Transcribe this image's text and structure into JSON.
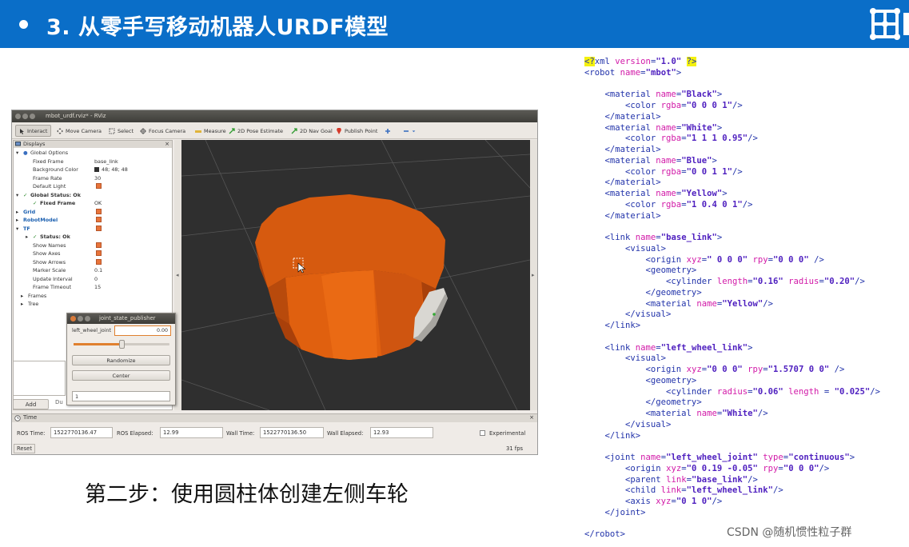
{
  "header": {
    "title": "3. 从零手写移动机器人URDF模型",
    "accent_color": "#0a6ec8"
  },
  "rviz": {
    "window_title": "mbot_urdf.rviz* - RViz",
    "toolbar": [
      {
        "label": "Interact",
        "icon": "interact-icon"
      },
      {
        "label": "Move Camera",
        "icon": "move-camera-icon"
      },
      {
        "label": "Select",
        "icon": "select-icon"
      },
      {
        "label": "Focus Camera",
        "icon": "focus-camera-icon"
      },
      {
        "label": "Measure",
        "icon": "measure-icon"
      },
      {
        "label": "2D Pose Estimate",
        "icon": "pose-estimate-icon"
      },
      {
        "label": "2D Nav Goal",
        "icon": "nav-goal-icon"
      },
      {
        "label": "Publish Point",
        "icon": "publish-point-icon"
      }
    ],
    "displays": {
      "title": "Displays",
      "rows": [
        {
          "label": "Global Options",
          "value": ""
        },
        {
          "label": "Fixed Frame",
          "value": "base_link"
        },
        {
          "label": "Background Color",
          "value": "48; 48; 48"
        },
        {
          "label": "Frame Rate",
          "value": "30"
        },
        {
          "label": "Default Light",
          "value": ""
        },
        {
          "label": "Global Status: Ok",
          "value": ""
        },
        {
          "label": "Fixed Frame",
          "value": "OK"
        },
        {
          "label": "Grid",
          "value": ""
        },
        {
          "label": "RobotModel",
          "value": ""
        },
        {
          "label": "TF",
          "value": ""
        },
        {
          "label": "Status: Ok",
          "value": ""
        },
        {
          "label": "Show Names",
          "value": ""
        },
        {
          "label": "Show Axes",
          "value": ""
        },
        {
          "label": "Show Arrows",
          "value": ""
        },
        {
          "label": "Marker Scale",
          "value": "0.1"
        },
        {
          "label": "Update Interval",
          "value": "0"
        },
        {
          "label": "Frame Timeout",
          "value": "15"
        },
        {
          "label": "Frames",
          "value": ""
        },
        {
          "label": "Tree",
          "value": ""
        }
      ],
      "add_label": "Add",
      "du_label": "Du"
    },
    "joint_state_publisher": {
      "title": "joint_state_publisher",
      "joint_label": "left_wheel_joint",
      "joint_value": "0.00",
      "slider_fraction": 0.5,
      "randomize_label": "Randomize",
      "center_label": "Center",
      "spin_value": "1"
    },
    "time": {
      "title": "Time",
      "ros_time_label": "ROS Time:",
      "ros_time": "1522770136.47",
      "ros_elapsed_label": "ROS Elapsed:",
      "ros_elapsed": "12.99",
      "wall_time_label": "Wall Time:",
      "wall_time": "1522770136.50",
      "wall_elapsed_label": "Wall Elapsed:",
      "wall_elapsed": "12.93",
      "experimental_label": "Experimental",
      "reset_label": "Reset",
      "fps": "31 fps"
    },
    "model_color": "#d95b10"
  },
  "caption": "第二步：使用圆柱体创建左侧车轮",
  "code_lines": [
    "<?xml version=\"1.0\" ?>",
    "<robot name=\"mbot\">",
    "",
    "    <material name=\"Black\">",
    "        <color rgba=\"0 0 0 1\"/>",
    "    </material>",
    "    <material name=\"White\">",
    "        <color rgba=\"1 1 1 0.95\"/>",
    "    </material>",
    "    <material name=\"Blue\">",
    "        <color rgba=\"0 0 1 1\"/>",
    "    </material>",
    "    <material name=\"Yellow\">",
    "        <color rgba=\"1 0.4 0 1\"/>",
    "    </material>",
    "",
    "    <link name=\"base_link\">",
    "        <visual>",
    "            <origin xyz=\" 0 0 0\" rpy=\"0 0 0\" />",
    "            <geometry>",
    "                <cylinder length=\"0.16\" radius=\"0.20\"/>",
    "            </geometry>",
    "            <material name=\"Yellow\"/>",
    "        </visual>",
    "    </link>",
    "",
    "    <link name=\"left_wheel_link\">",
    "        <visual>",
    "            <origin xyz=\"0 0 0\" rpy=\"1.5707 0 0\" />",
    "            <geometry>",
    "                <cylinder radius=\"0.06\" length = \"0.025\"/>",
    "            </geometry>",
    "            <material name=\"White\"/>",
    "        </visual>",
    "    </link>",
    "",
    "    <joint name=\"left_wheel_joint\" type=\"continuous\">",
    "        <origin xyz=\"0 0.19 -0.05\" rpy=\"0 0 0\"/>",
    "        <parent link=\"base_link\"/>",
    "        <child link=\"left_wheel_link\"/>",
    "        <axis xyz=\"0 1 0\"/>",
    "    </joint>",
    "",
    "</robot>"
  ],
  "watermark": "CSDN @随机惯性粒子群"
}
